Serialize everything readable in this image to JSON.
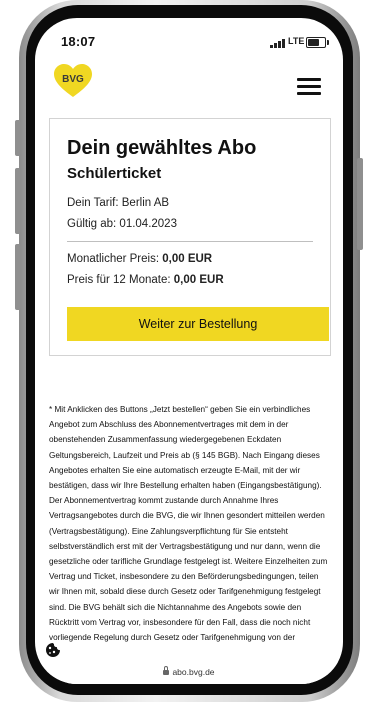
{
  "status_bar": {
    "time": "18:07",
    "network": "LTE"
  },
  "header": {
    "logo_text": "BVG",
    "menu_icon": "hamburger-menu-icon",
    "brand_color": "#F0D722"
  },
  "card": {
    "title": "Dein gewähltes Abo",
    "subtitle": "Schülerticket",
    "tariff": "Dein Tarif: Berlin AB",
    "valid_from": "Gültig ab: 01.04.2023",
    "monthly_price_label": "Monatlicher Preis:",
    "monthly_price_value": "0,00 EUR",
    "yearly_price_label": "Preis für 12 Monate:",
    "yearly_price_value": "0,00 EUR",
    "cta_label": "Weiter zur Bestellung"
  },
  "legal": {
    "text": "* Mit Anklicken des Buttons „Jetzt bestellen“ geben Sie ein verbindliches Angebot zum Abschluss des Abonnementvertrages mit dem in der obenstehenden Zusammenfassung wiedergegebenen Eckdaten Geltungsbereich, Laufzeit und Preis ab (§ 145 BGB). Nach Eingang dieses Angebotes erhalten Sie eine automatisch erzeugte E-Mail, mit der wir bestätigen, dass wir Ihre Bestellung erhalten haben (Eingangsbestätigung). Der Abonnementvertrag kommt zustande durch Annahme Ihres Vertragsangebotes durch die BVG, die wir Ihnen gesondert mitteilen werden (Vertragsbestätigung). Eine Zahlungsverpflichtung für Sie entsteht selbstverständlich erst mit der Vertragsbestätigung und nur dann, wenn die gesetzliche oder tarifliche Grundlage festgelegt ist. Weitere Einzelheiten zum Vertrag und Ticket, insbesondere zu den Beförderungsbedingungen, teilen wir Ihnen mit, sobald diese durch Gesetz oder Tarifgenehmigung festgelegt sind. Die BVG behält sich die Nichtannahme des Angebots sowie den Rücktritt vom Vertrag vor, insbesondere für den Fall, dass die noch nicht vorliegende Regelung durch Gesetz oder Tarifgenehmigung von der"
  },
  "cookie_icon": "cookie-icon",
  "browser": {
    "url": "abo.bvg.de"
  }
}
